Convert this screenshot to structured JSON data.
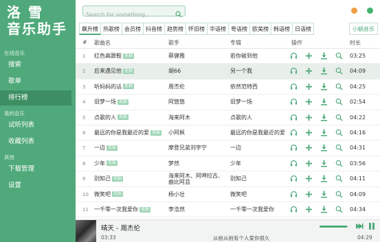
{
  "app": {
    "logo_line1": "洛 雪",
    "logo_line2": "音乐助手",
    "accent": "#4fa97a",
    "sidebar_active": "#3d8f63"
  },
  "sidebar": {
    "section_online": "在线音乐",
    "section_mine": "我的音乐",
    "section_other": "其他",
    "items": [
      {
        "label": "搜索",
        "active": false
      },
      {
        "label": "歌单",
        "active": false
      },
      {
        "label": "排行榜",
        "active": true
      },
      {
        "label": "试听列表",
        "active": false
      },
      {
        "label": "收藏列表",
        "active": false
      },
      {
        "label": "下载管理",
        "active": false
      },
      {
        "label": "设置",
        "active": false
      }
    ]
  },
  "search": {
    "placeholder": "Search for something...",
    "value": "",
    "icon": "search-icon"
  },
  "window_controls": {
    "minimize_color": "#f0a046",
    "close_color": "#42b36b"
  },
  "tabs": [
    {
      "label": "飙升榜",
      "active": true
    },
    {
      "label": "热歌榜",
      "active": false
    },
    {
      "label": "会员榜",
      "active": false
    },
    {
      "label": "抖音榜",
      "active": false
    },
    {
      "label": "趋势榜",
      "active": false
    },
    {
      "label": "怀旧榜",
      "active": false
    },
    {
      "label": "华语榜",
      "active": false
    },
    {
      "label": "粤语榜",
      "active": false
    },
    {
      "label": "欧美榜",
      "active": false
    },
    {
      "label": "韩语榜",
      "active": false
    },
    {
      "label": "日语榜",
      "active": false
    }
  ],
  "source_tab": "小蜗音乐",
  "table": {
    "headers": {
      "num": "#",
      "title": "歌曲名",
      "artist": "歌手",
      "album": "专辑",
      "actions": "操作",
      "time": "时长"
    },
    "lossless_badge": "无损",
    "action_icons": [
      "headphones-icon",
      "add-icon",
      "download-icon",
      "search-icon"
    ],
    "rows": [
      {
        "num": "1",
        "title": "红色高跟鞋",
        "lossless": true,
        "artist": "蔡健雅",
        "artist2": "",
        "album": "若你碰到他",
        "time": "03:25",
        "selected": false
      },
      {
        "num": "2",
        "title": "后来遇见他",
        "lossless": true,
        "artist": "胡66",
        "artist2": "",
        "album": "另一个我",
        "time": "04:09",
        "selected": true
      },
      {
        "num": "3",
        "title": "听妈妈的话",
        "lossless": true,
        "artist": "周杰伦",
        "artist2": "",
        "album": "依然范特西",
        "time": "04:25",
        "selected": false
      },
      {
        "num": "4",
        "title": "旧梦一场",
        "lossless": true,
        "artist": "阿悠悠",
        "artist2": "",
        "album": "旧梦一场",
        "time": "02:54",
        "selected": false
      },
      {
        "num": "5",
        "title": "点歌的人",
        "lossless": true,
        "artist": "海来阿木",
        "artist2": "",
        "album": "点歌的人",
        "time": "04:22",
        "selected": false
      },
      {
        "num": "6",
        "title": "最远的你是我最近的爱",
        "lossless": true,
        "artist": "小阿枫",
        "artist2": "",
        "album": "最远的你是我最近的爱",
        "time": "04:16",
        "selected": false
      },
      {
        "num": "7",
        "title": "一边",
        "lossless": true,
        "artist": "摩登兄弟刘宇宁",
        "artist2": "",
        "album": "一边",
        "time": "04:31",
        "selected": false
      },
      {
        "num": "8",
        "title": "少年",
        "lossless": true,
        "artist": "梦然",
        "artist2": "",
        "album": "少年",
        "time": "03:56",
        "selected": false
      },
      {
        "num": "9",
        "title": "别知己",
        "lossless": true,
        "artist": "海来阿木、阿呷拉古、",
        "artist2": "曲比阿且",
        "album": "别知己",
        "time": "04:11",
        "selected": false
      },
      {
        "num": "10",
        "title": "微笑吧",
        "lossless": true,
        "artist": "杨小壮",
        "artist2": "",
        "album": "微笑吧",
        "time": "04:09",
        "selected": false
      },
      {
        "num": "11",
        "title": "一千零一次我爱你",
        "lossless": true,
        "artist": "李浩然",
        "artist2": "",
        "album": "一千零一次我爱你",
        "time": "04:34",
        "selected": false
      }
    ]
  },
  "player": {
    "title": "晴天 - 周杰伦",
    "current": "03:33",
    "lyric": "从前从前有个人爱你很久",
    "total": "04:29",
    "volume": 0.95,
    "buttons": [
      "next-icon",
      "pause-icon"
    ]
  }
}
